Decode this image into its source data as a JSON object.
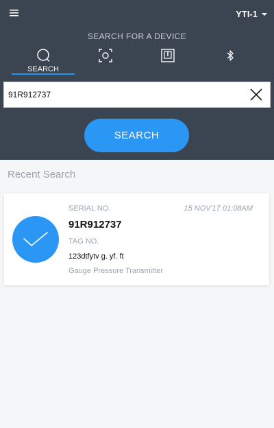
{
  "header": {
    "device_selector": "YTI-1",
    "search_title": "SEARCH FOR A DEVICE",
    "tabs": [
      {
        "label": "SEARCH",
        "icon": "search-icon",
        "active": true
      },
      {
        "label": "",
        "icon": "scan-icon",
        "active": false
      },
      {
        "label": "",
        "icon": "tag-reader-icon",
        "active": false
      },
      {
        "label": "",
        "icon": "bluetooth-icon",
        "active": false
      }
    ]
  },
  "search": {
    "value": "91R912737",
    "button_label": "SEARCH"
  },
  "recent": {
    "title": "Recent Search",
    "items": [
      {
        "serial_label": "SERIAL NO.",
        "serial_value": "91R912737",
        "tag_label": "TAG NO.",
        "tag_value": "123dtfytv g. yf.  ft",
        "device_type": "Gauge Pressure Transmitter",
        "timestamp": "15 NOV'17 01:08AM"
      }
    ]
  },
  "colors": {
    "header_bg": "#3b4551",
    "accent": "#2b97f4",
    "background": "#f5f6f8",
    "muted_text": "#9aa3ad"
  }
}
